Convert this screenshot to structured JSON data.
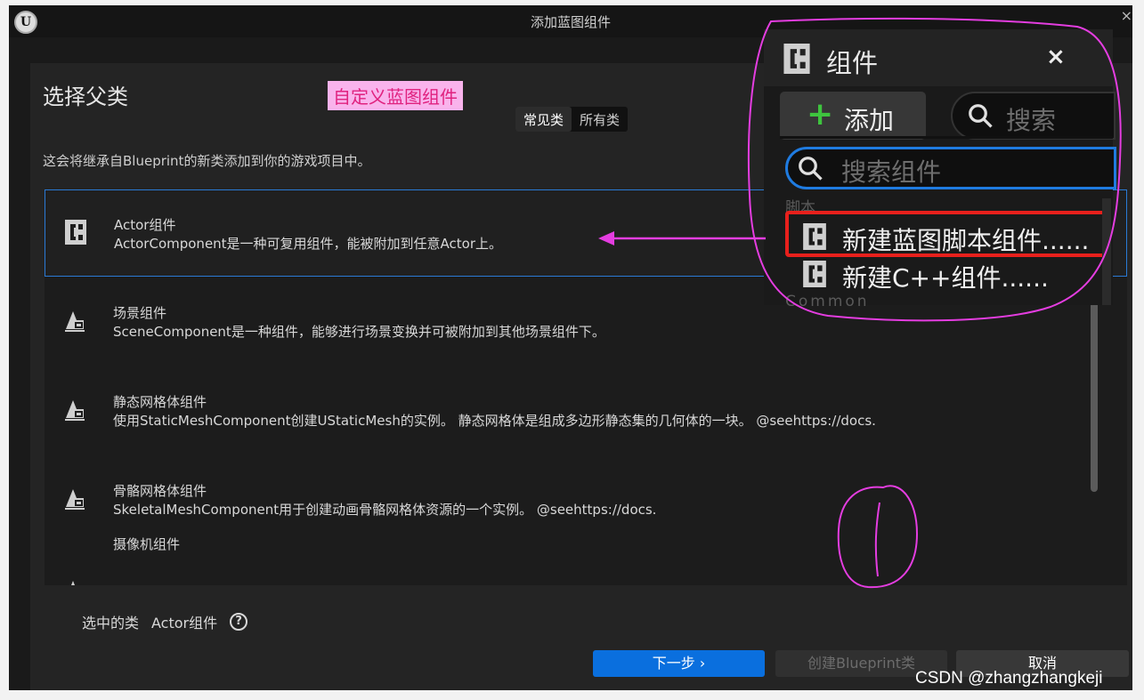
{
  "window": {
    "title": "添加蓝图组件",
    "close_glyph": "×",
    "logo_glyph": "U"
  },
  "dialog": {
    "heading": "选择父类",
    "annotation_label": "自定义蓝图组件",
    "tabs": [
      {
        "label": "常见类",
        "active": true
      },
      {
        "label": "所有类",
        "active": false
      }
    ],
    "description": "这会将继承自Blueprint的新类添加到你的游戏项目中。",
    "items": [
      {
        "name": "Actor组件",
        "description": "ActorComponent是一种可复用组件，能被附加到任意Actor上。",
        "icon": "c-class-icon",
        "selected": true
      },
      {
        "name": "场景组件",
        "description": "SceneComponent是一种组件，能够进行场景变换并可被附加到其他场景组件下。",
        "icon": "scene-component-icon",
        "selected": false
      },
      {
        "name": "静态网格体组件",
        "description": "使用StaticMeshComponent创建UStaticMesh的实例。 静态网格体是组成多边形静态集的几何体的一块。 @seehttps://docs.",
        "icon": "static-mesh-icon",
        "selected": false
      },
      {
        "name": "骨骼网格体组件",
        "description": "SkeletalMeshComponent用于创建动画骨骼网格体资源的一个实例。 @seehttps://docs.",
        "icon": "skeletal-mesh-icon",
        "selected": false
      },
      {
        "name": "摄像机组件",
        "description": "",
        "icon": "camera-icon",
        "selected": false
      }
    ],
    "selected_class_label": "选中的类",
    "selected_class_value": "Actor组件",
    "help_glyph": "?",
    "buttons": {
      "next": "下一步 ›",
      "create": "创建Blueprint类",
      "cancel": "取消"
    }
  },
  "components_panel": {
    "title": "组件",
    "close_glyph": "×",
    "add_label": "添加",
    "plus_glyph": "+",
    "search_placeholder": "搜索",
    "component_search_placeholder": "搜索组件",
    "category": "脚本",
    "options": [
      {
        "label": "新建蓝图脚本组件......",
        "highlighted": true
      },
      {
        "label": "新建C++组件......",
        "highlighted": false
      }
    ],
    "next_category": "Common"
  },
  "watermark": "CSDN @zhangzhangkeji",
  "colors": {
    "accent": "#0a6fde",
    "selection_border": "#2a7ad5",
    "annotation_pink": "#e43de0",
    "highlight_red": "#e8201c"
  }
}
